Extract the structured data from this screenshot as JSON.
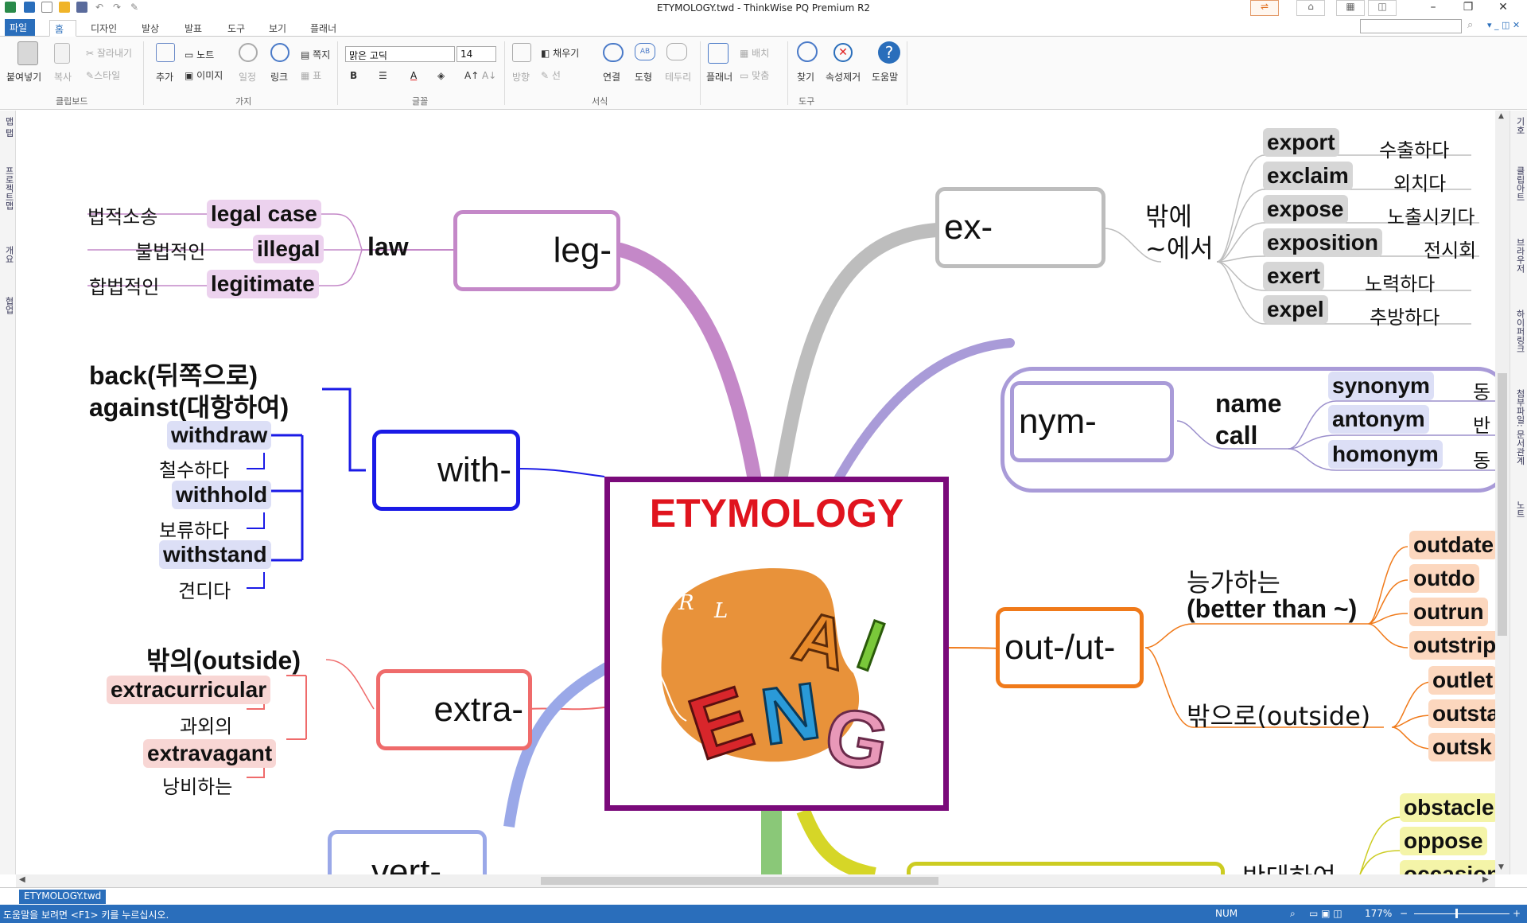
{
  "window": {
    "title": "ETYMOLOGY.twd - ThinkWise PQ Premium R2"
  },
  "tabs": [
    {
      "label": "파일"
    },
    {
      "label": "홈"
    },
    {
      "label": "디자인"
    },
    {
      "label": "발상"
    },
    {
      "label": "발표"
    },
    {
      "label": "도구"
    },
    {
      "label": "보기"
    },
    {
      "label": "플래너"
    }
  ],
  "ribbon": {
    "clipboard": {
      "paste": "붙여넣기",
      "copy": "복사",
      "cut": "잘라내기",
      "style": "스타일",
      "group": "클립보드"
    },
    "branch": {
      "add": "추가",
      "note": "노트",
      "image": "이미지",
      "schedule": "일정",
      "link": "링크",
      "memo": "쪽지",
      "table": "표",
      "group": "가지"
    },
    "font": {
      "family": "맑은 고딕",
      "size": "14",
      "bold": "B",
      "group": "글꼴"
    },
    "format": {
      "direction": "방향",
      "fill": "채우기",
      "line": "선",
      "connect": "연결",
      "shape": "도형",
      "border": "테두리",
      "group": "서식"
    },
    "planner": {
      "planner": "플래너",
      "arrange": "배치",
      "fit": "맞춤"
    },
    "tools": {
      "find": "찾기",
      "remove_attr": "속성제거",
      "help": "도움말",
      "group": "도구"
    }
  },
  "left_sidebar": [
    "맵 탭",
    "프로젝트맵",
    "개요",
    "협업"
  ],
  "right_sidebar": [
    "기호",
    "클립아트",
    "브라우저",
    "하이퍼링크",
    "첨부파일: 문서관계",
    "노트"
  ],
  "mindmap": {
    "center": {
      "title": "ETYMOLOGY"
    },
    "leg": {
      "node": "leg-",
      "label": "law",
      "items": [
        {
          "word": "legal case",
          "meaning": "법적소송"
        },
        {
          "word": "illegal",
          "meaning": "불법적인"
        },
        {
          "word": "legitimate",
          "meaning": "합법적인"
        }
      ]
    },
    "with": {
      "node": "with-",
      "label1": "back(뒤쪽으로)",
      "label2": "against(대항하여)",
      "items": [
        {
          "word": "withdraw",
          "meaning": "철수하다"
        },
        {
          "word": "withhold",
          "meaning": "보류하다"
        },
        {
          "word": "withstand",
          "meaning": "견디다"
        }
      ]
    },
    "extra": {
      "node": "extra-",
      "label": "밖의(outside)",
      "items": [
        {
          "word": "extracurricular",
          "meaning": "과외의"
        },
        {
          "word": "extravagant",
          "meaning": "낭비하는"
        }
      ]
    },
    "vert": {
      "node": "vert-"
    },
    "ex": {
      "node": "ex-",
      "label1": "밖에",
      "label2": "~에서",
      "items": [
        {
          "word": "export",
          "meaning": "수출하다"
        },
        {
          "word": "exclaim",
          "meaning": "외치다"
        },
        {
          "word": "expose",
          "meaning": "노출시키다"
        },
        {
          "word": "exposition",
          "meaning": "전시회"
        },
        {
          "word": "exert",
          "meaning": "노력하다"
        },
        {
          "word": "expel",
          "meaning": "추방하다"
        }
      ]
    },
    "nym": {
      "node": "nym-",
      "label1": "name",
      "label2": "call",
      "items": [
        {
          "word": "synonym",
          "meaning": "동"
        },
        {
          "word": "antonym",
          "meaning": "반"
        },
        {
          "word": "homonym",
          "meaning": "동"
        }
      ]
    },
    "out": {
      "node": "out-/ut-",
      "label1a": "능가하는",
      "label1b": "(better than ~)",
      "items1": [
        "outdate",
        "outdo",
        "outrun",
        "outstrip"
      ],
      "label2": "밖으로(outside)",
      "items2": [
        "outlet",
        "outsta",
        "outsk"
      ]
    },
    "ob": {
      "label": "반대하여",
      "items": [
        "obstacle",
        "oppose",
        "occasion"
      ]
    }
  },
  "doc_tab": "ETYMOLOGY.twd",
  "status": {
    "help": "도움말을 보려면 <F1> 키를 누르십시오.",
    "num": "NUM",
    "zoom": "177%"
  },
  "colors": {
    "leg": "#c488c8",
    "with": "#1a1ae6",
    "extra": "#ef6b6b",
    "ex": "#b0b0b0",
    "nym": "#9b8fcc",
    "out": "#f07a1a",
    "ob": "#cccc22",
    "center_border": "#7a0a7a",
    "center_title": "#e0141e",
    "accent": "#2a6ebb"
  }
}
